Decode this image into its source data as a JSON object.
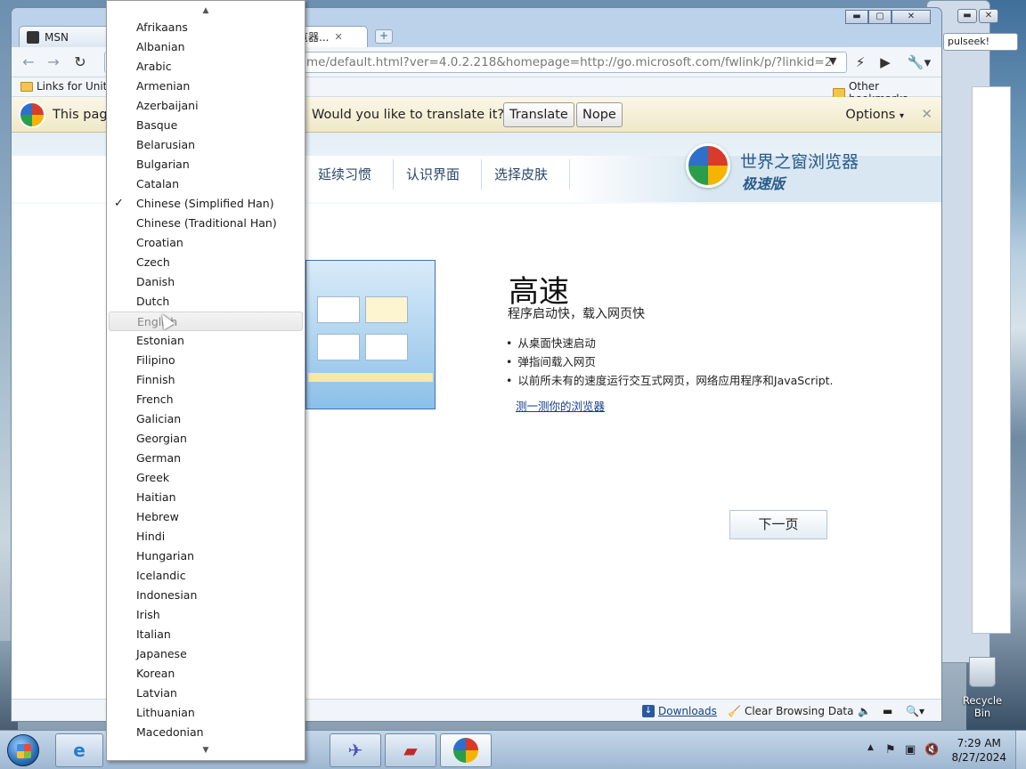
{
  "browser": {
    "tabs": [
      {
        "title": "MSN"
      },
      {
        "title": "浏览器..."
      }
    ],
    "new_tab": "+",
    "address": "me/default.html?ver=4.0.2.218&homepage=http://go.microsoft.com/fwlink/p/?linkid=2",
    "bookmarks": {
      "left": "Links for Unite",
      "right": "Other bookmarks"
    },
    "window_controls": {
      "minimize": "▬",
      "maximize": "▢",
      "close": "✕"
    }
  },
  "background_window": {
    "tab_text": "pulseek!"
  },
  "infobar": {
    "prefix": "This page",
    "question": "Would you like to translate it?",
    "translate_label": "Translate",
    "nope_label": "Nope",
    "options_label": "Options",
    "close_glyph": "✕"
  },
  "page": {
    "wizard_steps": [
      "延续习惯",
      "认识界面",
      "选择皮肤"
    ],
    "brand_title": "世界之窗浏览器",
    "brand_subtitle": "极速版",
    "feature_title": "高速",
    "feature_subtitle": "程序启动快，载入网页快",
    "features": [
      "从桌面快速启动",
      "弹指间载入网页",
      "以前所未有的速度运行交互式网页，网络应用程序和JavaScript."
    ],
    "test_link": "测一测你的浏览器",
    "next_button": "下一页"
  },
  "statusbar": {
    "downloads": "Downloads",
    "clear_data": "Clear Browsing Data"
  },
  "language_menu": {
    "selected": "Chinese (Simplified Han)",
    "hovered": "English",
    "items": [
      "Afrikaans",
      "Albanian",
      "Arabic",
      "Armenian",
      "Azerbaijani",
      "Basque",
      "Belarusian",
      "Bulgarian",
      "Catalan",
      "Chinese (Simplified Han)",
      "Chinese (Traditional Han)",
      "Croatian",
      "Czech",
      "Danish",
      "Dutch",
      "English",
      "Estonian",
      "Filipino",
      "Finnish",
      "French",
      "Galician",
      "Georgian",
      "German",
      "Greek",
      "Haitian",
      "Hebrew",
      "Hindi",
      "Hungarian",
      "Icelandic",
      "Indonesian",
      "Irish",
      "Italian",
      "Japanese",
      "Korean",
      "Latvian",
      "Lithuanian",
      "Macedonian"
    ]
  },
  "desktop": {
    "recycle_bin": "Recycle Bin"
  },
  "taskbar": {
    "time": "7:29 AM",
    "date": "8/27/2024"
  }
}
